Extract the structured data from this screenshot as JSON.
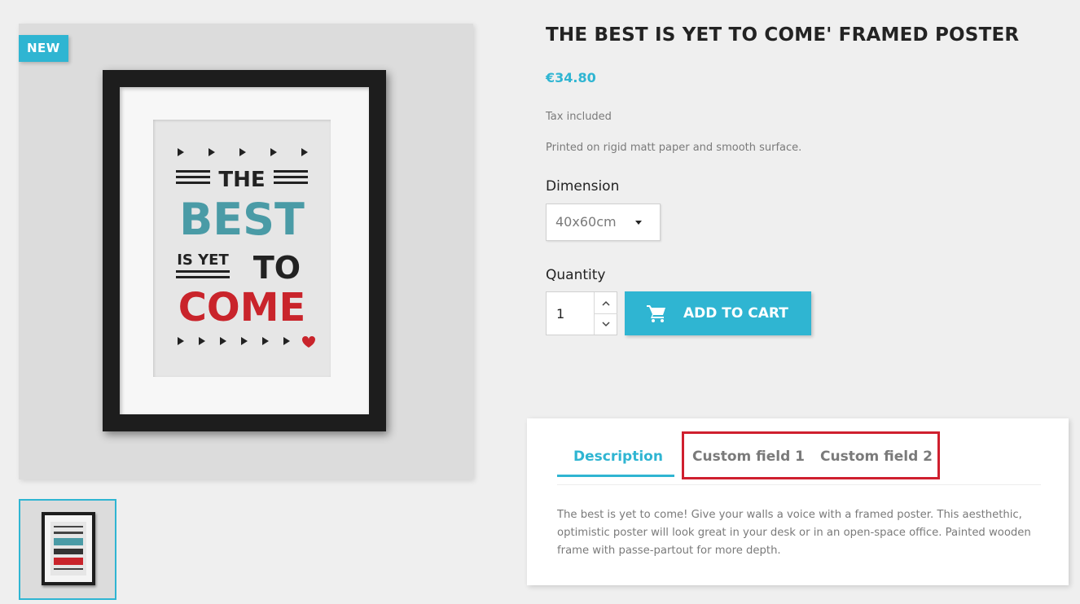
{
  "product": {
    "badge": "NEW",
    "title": "THE BEST IS YET TO COME' FRAMED POSTER",
    "price": "€34.80",
    "tax_note": "Tax included",
    "short_description": "Printed on rigid matt paper and smooth surface."
  },
  "poster_art": {
    "line1": "THE",
    "line2": "BEST",
    "line3a": "IS YET",
    "line3b": "TO",
    "line4": "COME"
  },
  "options": {
    "dimension_label": "Dimension",
    "dimension_value": "40x60cm",
    "quantity_label": "Quantity",
    "quantity_value": "1"
  },
  "actions": {
    "add_to_cart": "ADD TO CART"
  },
  "tabs": {
    "items": [
      {
        "label": "Description",
        "active": true
      },
      {
        "label": "Custom field 1",
        "active": false
      },
      {
        "label": "Custom field 2",
        "active": false
      }
    ],
    "description_text": "The best is yet to come! Give your walls a voice with a framed poster. This aesthethic, optimistic poster will look great in your desk or in an open-space office. Painted wooden frame with passe-partout for more depth."
  },
  "colors": {
    "accent": "#2fb5d2",
    "highlight_border": "#cf1f2e",
    "poster_teal": "#4a9ba6",
    "poster_red": "#c9242b"
  },
  "icons": [
    "cart-icon",
    "chevron-up-icon",
    "chevron-down-icon",
    "caret-down-icon"
  ]
}
